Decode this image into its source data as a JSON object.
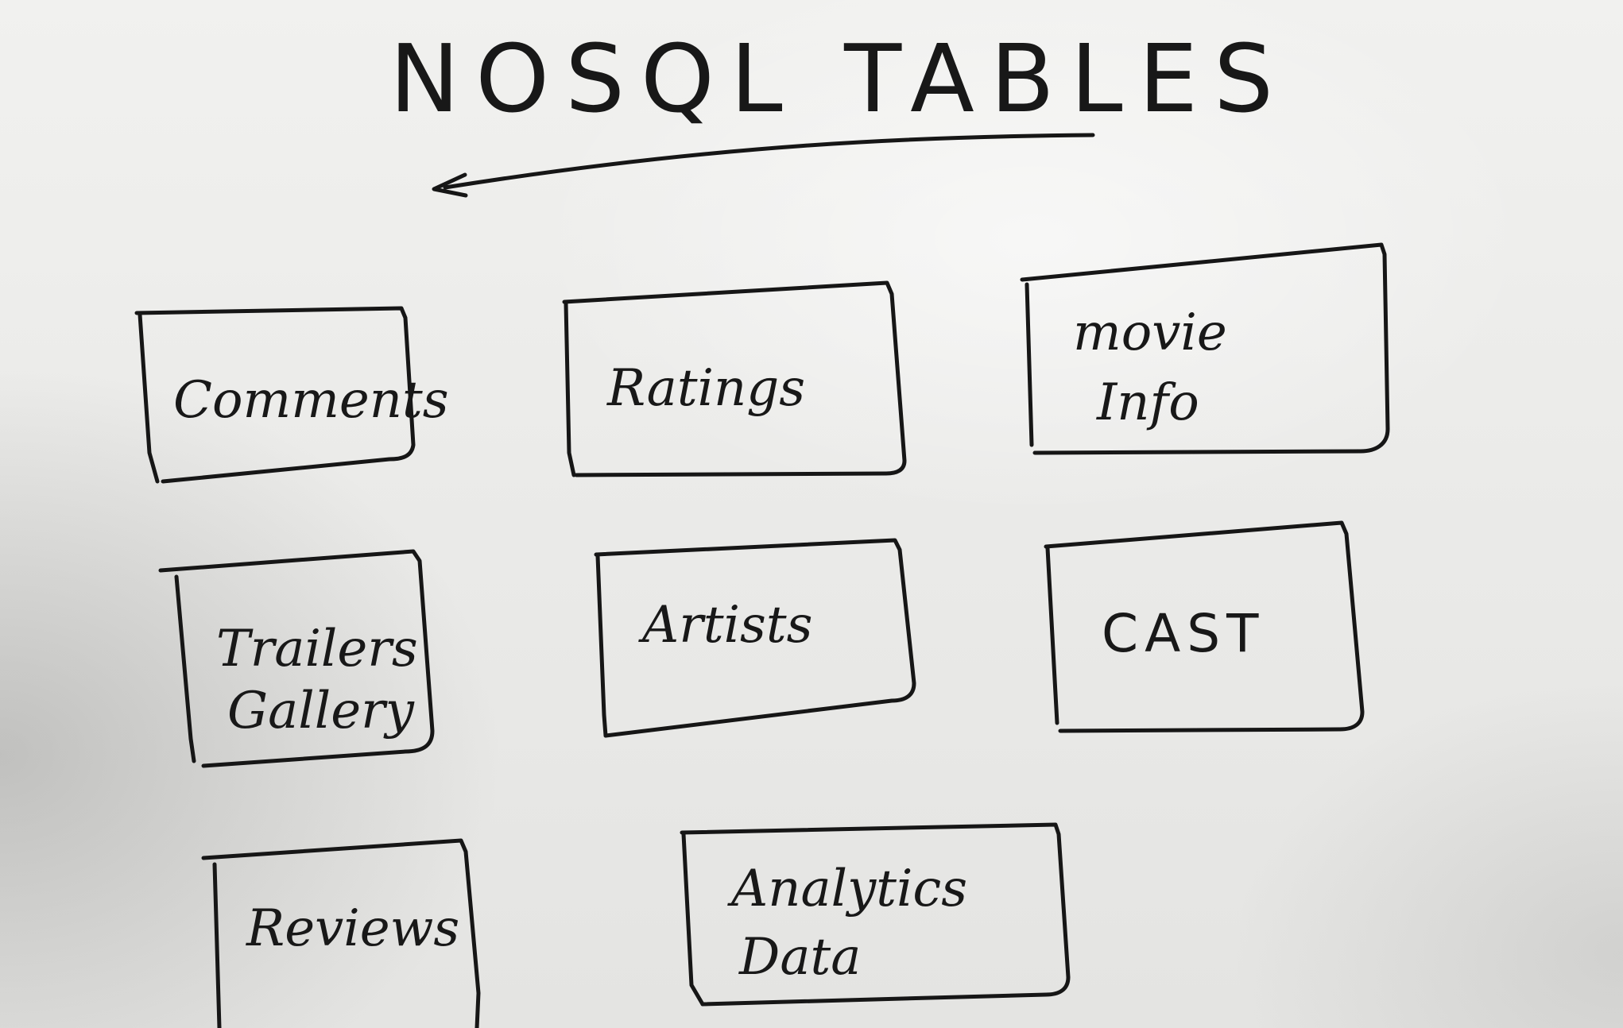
{
  "title": "NOSQL TABLES",
  "tables": [
    {
      "lines": [
        "Comments"
      ]
    },
    {
      "lines": [
        "Ratings"
      ]
    },
    {
      "lines": [
        "movie",
        "Info"
      ]
    },
    {
      "lines": [
        "Trailers",
        "Gallery"
      ]
    },
    {
      "lines": [
        "Artists"
      ]
    },
    {
      "lines": [
        "CAST"
      ]
    },
    {
      "lines": [
        "Reviews"
      ]
    },
    {
      "lines": [
        "Analytics",
        "Data"
      ]
    }
  ],
  "colors": {
    "ink": "#161616",
    "board": "#ececea"
  }
}
